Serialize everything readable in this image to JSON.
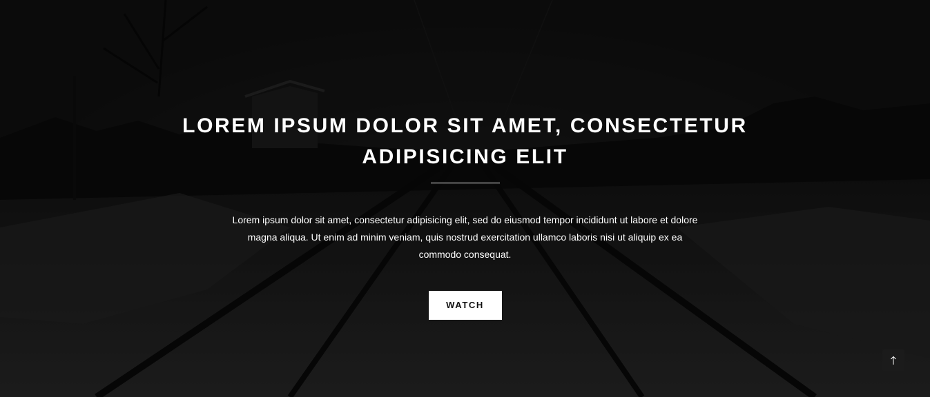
{
  "hero": {
    "headline": "LOREM IPSUM DOLOR SIT AMET, CONSECTETUR ADIPISICING ELIT",
    "body": "Lorem ipsum dolor sit amet, consectetur adipisicing elit, sed do eiusmod tempor incididunt ut labore et dolore magna aliqua. Ut enim ad minim veniam, quis nostrud exercitation ullamco laboris nisi ut aliquip ex ea commodo consequat.",
    "button_label": "WATCH"
  },
  "scroll_top": {
    "icon": "arrow-up-icon"
  },
  "colors": {
    "background": "#0d0d0d",
    "text": "#ffffff",
    "button_bg": "#ffffff",
    "button_text": "#111111"
  }
}
